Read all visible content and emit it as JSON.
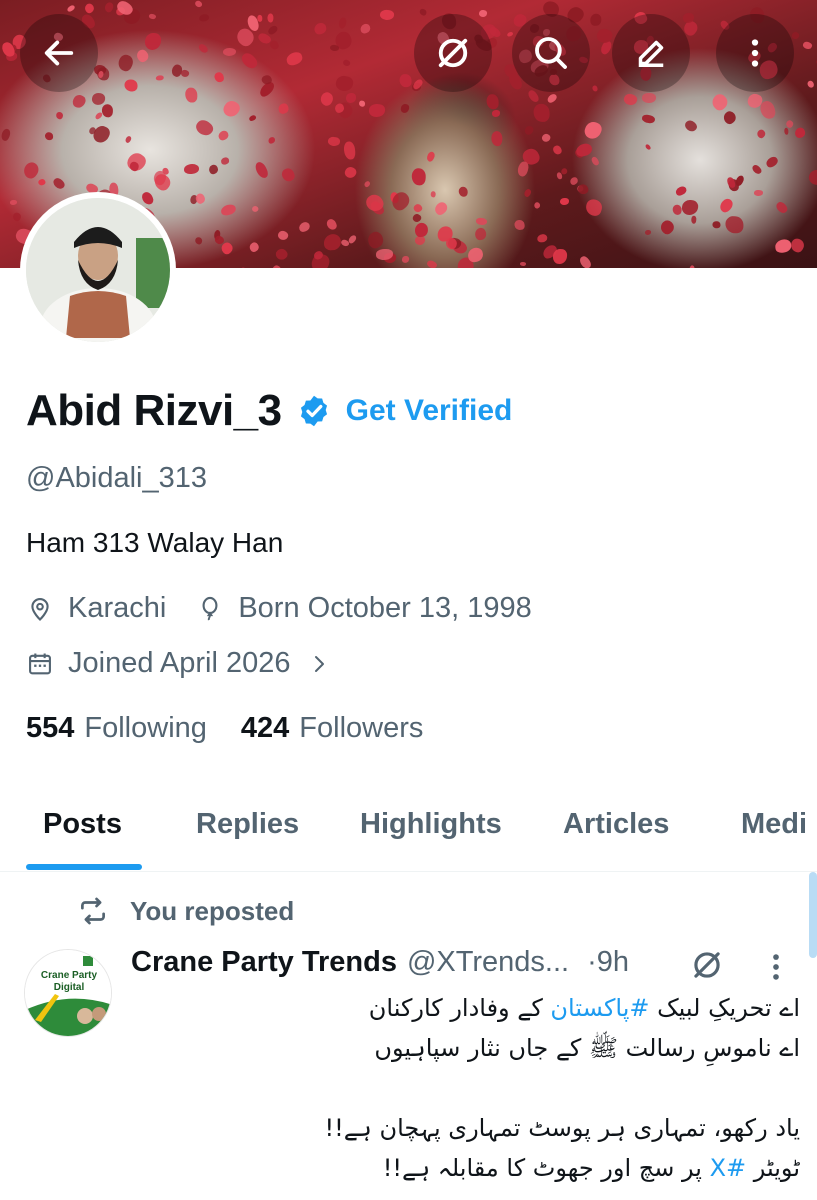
{
  "header": {
    "back_icon": "arrow-left-icon",
    "grok_icon": "grok-icon",
    "search_icon": "search-icon",
    "compose_icon": "pencil-icon",
    "more_icon": "more-vertical-icon"
  },
  "profile": {
    "display_name": "Abid Rizvi_3",
    "verified_badge_icon": "verified-badge-icon",
    "get_verified_label": "Get Verified",
    "handle": "@Abidali_313",
    "bio": "Ham 313 Walay Han",
    "location": "Karachi",
    "birthday": "Born October 13, 1998",
    "joined": "Joined April 2026",
    "following_count": "554",
    "following_label": "Following",
    "followers_count": "424",
    "followers_label": "Followers"
  },
  "tabs": [
    {
      "label": "Posts",
      "active": true
    },
    {
      "label": "Replies",
      "active": false
    },
    {
      "label": "Highlights",
      "active": false
    },
    {
      "label": "Articles",
      "active": false
    },
    {
      "label": "Medi",
      "active": false
    }
  ],
  "feed": {
    "repost_label": "You reposted",
    "post": {
      "author": "Crane Party Trends",
      "handle": "@XTrends...",
      "time": "·9h",
      "avatar_text_1": "Crane Party",
      "avatar_text_2": "Digital",
      "lines": [
        {
          "pre": "اے تحریکِ لبیک ",
          "tag": "#پاکستان",
          "post": " کے وفادار کارکنان"
        },
        {
          "pre": "اے ناموسِ رسالت ﷺ کے جاں نثار سپاہیوں",
          "tag": "",
          "post": ""
        },
        {
          "pre": "",
          "tag": "",
          "post": ""
        },
        {
          "pre": "یاد رکھو، تمہاری ہر پوسٹ تمہاری پہچان ہے!!",
          "tag": "",
          "post": ""
        },
        {
          "pre": "ٹویٹر ",
          "tag": "#X",
          "post": " پر سچ اور جھوٹ کا مقابلہ ہے!!"
        }
      ]
    }
  },
  "colors": {
    "accent": "#1d9bf0",
    "text_primary": "#0f1419",
    "text_secondary": "#536471"
  }
}
